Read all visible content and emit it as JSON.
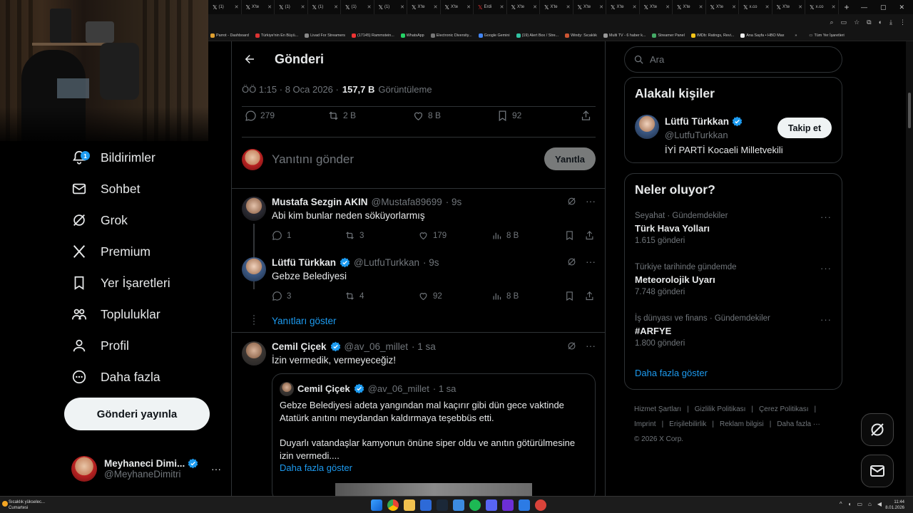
{
  "browser": {
    "tabs": [
      {
        "label": "(1)",
        "icon": "x"
      },
      {
        "label": "X'te",
        "icon": "x"
      },
      {
        "label": "(1)",
        "icon": "x"
      },
      {
        "label": "(1)",
        "icon": "x"
      },
      {
        "label": "(1)",
        "icon": "x"
      },
      {
        "label": "(1)",
        "icon": "x"
      },
      {
        "label": "X'te",
        "icon": "x"
      },
      {
        "label": "X'te",
        "icon": "x"
      },
      {
        "label": "Erdi",
        "icon": "x-red"
      },
      {
        "label": "X'te",
        "icon": "x"
      },
      {
        "label": "X'te",
        "icon": "x"
      },
      {
        "label": "X'te",
        "icon": "x"
      },
      {
        "label": "X'te",
        "icon": "x"
      },
      {
        "label": "X'te",
        "icon": "x"
      },
      {
        "label": "X'te",
        "icon": "x"
      },
      {
        "label": "X'te",
        "icon": "x"
      },
      {
        "label": "x.co",
        "icon": "x"
      },
      {
        "label": "X'te",
        "icon": "x"
      },
      {
        "label": "x.co",
        "icon": "x"
      }
    ],
    "new_tab": "+",
    "bookmarks": [
      "Parrot - Dashboard",
      "Türkiye'nin En Büyü...",
      "Livad For Streamers",
      "(17145) Rammstein...",
      "WhatsApp",
      "Electronic Diversity...",
      "Google Gemini",
      "(19) Alert Box / Stre...",
      "Windy: Sıcaklık",
      "Multi TV - 6 haber k...",
      "Streamer Panel",
      "IMDb: Ratings, Revi...",
      "Ana Sayfa • HBO Max"
    ],
    "bookmarks_overflow": "»",
    "all_bookmarks": "Tüm Yer İşaretleri"
  },
  "sidebar": {
    "items": [
      {
        "label": "Bildirimler",
        "icon": "bell-icon",
        "badge": "1"
      },
      {
        "label": "Sohbet",
        "icon": "mail-icon"
      },
      {
        "label": "Grok",
        "icon": "grok-icon"
      },
      {
        "label": "Premium",
        "icon": "x-logo-icon"
      },
      {
        "label": "Yer İşaretleri",
        "icon": "bookmark-icon"
      },
      {
        "label": "Topluluklar",
        "icon": "communities-icon"
      },
      {
        "label": "Profil",
        "icon": "person-icon"
      },
      {
        "label": "Daha fazla",
        "icon": "more-circle-icon"
      }
    ],
    "post_button": "Gönderi yayınla",
    "account": {
      "name": "Meyhaneci Dimi...",
      "handle": "@MeyhaneDimitri",
      "more": "···"
    }
  },
  "post": {
    "header": "Gönderi",
    "timestamp": "ÖÖ 1:15 · 8 Oca 2026 ·",
    "views_value": "157,7 B",
    "views_label": "Görüntüleme",
    "stats": {
      "replies": "279",
      "reposts": "2 B",
      "likes": "8 B",
      "bookmarks": "92"
    },
    "reply_placeholder": "Yanıtını gönder",
    "reply_button": "Yanıtla"
  },
  "replies": [
    {
      "name": "Mustafa Sezgin AKIN",
      "handle": "@Mustafa89699",
      "time": "· 9s",
      "verified": false,
      "text": "Abi kim bunlar neden söküyorlarmış",
      "stats": {
        "replies": "1",
        "reposts": "3",
        "likes": "179",
        "views": "8 B"
      }
    },
    {
      "name": "Lütfü Türkkan",
      "handle": "@LutfuTurkkan",
      "time": "· 9s",
      "verified": true,
      "text": "Gebze Belediyesi",
      "stats": {
        "replies": "3",
        "reposts": "4",
        "likes": "92",
        "views": "8 B"
      }
    },
    {
      "name": "Cemil Çiçek",
      "handle": "@av_06_millet",
      "time": "· 1 sa",
      "verified": true,
      "text": "İzin vermedik, vermeyeceğiz!"
    }
  ],
  "show_replies": "Yanıtları göster",
  "quote": {
    "name": "Cemil Çiçek",
    "handle": "@av_06_millet",
    "time": "· 1 sa",
    "line1": "Gebze Belediyesi adeta yangından mal kaçırır gibi dün gece vaktinde",
    "line2": "Atatürk anıtını meydandan kaldırmaya teşebbüs etti.",
    "line3": "Duyarlı vatandaşlar kamyonun önüne siper oldu ve anıtın götürülmesine",
    "line4": "izin vermedi....",
    "more": "Daha fazla göster"
  },
  "right": {
    "search_placeholder": "Ara",
    "related_title": "Alakalı kişiler",
    "related": {
      "name": "Lütfü Türkkan",
      "handle": "@LutfuTurkkan",
      "bio": "İYİ PARTİ Kocaeli Milletvekili",
      "follow": "Takip et"
    },
    "trends_title": "Neler oluyor?",
    "trends": [
      {
        "category": "Seyahat · Gündemdekiler",
        "name": "Türk Hava Yolları",
        "count": "1.615 gönderi"
      },
      {
        "category": "Türkiye tarihinde gündemde",
        "name": "Meteorolojik Uyarı",
        "count": "7.748 gönderi"
      },
      {
        "category": "İş dünyası ve finans · Gündemdekiler",
        "name": "#ARFYE",
        "count": "1.800 gönderi"
      }
    ],
    "trends_more": "Daha fazla göster",
    "footer": [
      "Hizmet Şartları",
      "|",
      "Gizlilik Politikası",
      "|",
      "Çerez Politikası",
      "|",
      "Imprint",
      "|",
      "Erişilebilirlik",
      "|",
      "Reklam bilgisi",
      "|",
      "Daha fazla ···"
    ],
    "copyright": "© 2026 X Corp."
  },
  "taskbar": {
    "weather_line1": "Sıcaklık yükselec...",
    "weather_line2": "Cumartesi",
    "time": "11:44",
    "date": "8.01.2026"
  },
  "colors": {
    "accent": "#1d9bf0",
    "text": "#e7e9ea",
    "muted": "#71767b",
    "border": "#2f3336"
  }
}
